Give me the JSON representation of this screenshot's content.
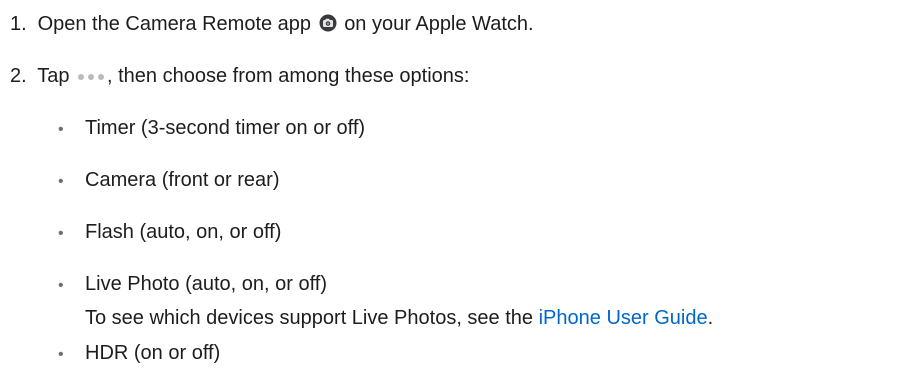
{
  "steps": [
    {
      "number": "1.",
      "text_before": "Open the Camera Remote app",
      "icon": "camera-remote-app-icon",
      "text_after": "on your Apple Watch."
    },
    {
      "number": "2.",
      "text_before": "Tap",
      "icon": "more-options-icon",
      "text_after": ", then choose from among these options:"
    }
  ],
  "options": [
    "Timer (3-second timer on or off)",
    "Camera (front or rear)",
    "Flash (auto, on, or off)",
    "Live Photo (auto, on, or off)",
    "HDR (on or off)"
  ],
  "bullet_symbol": "•",
  "live_photo_note": {
    "text_before": "To see which devices support Live Photos, see the",
    "link_text": "iPhone User Guide",
    "text_after": "."
  },
  "colors": {
    "text": "#1d1d1f",
    "link": "#0066cc",
    "icon_dots": "#b9b9bf"
  }
}
